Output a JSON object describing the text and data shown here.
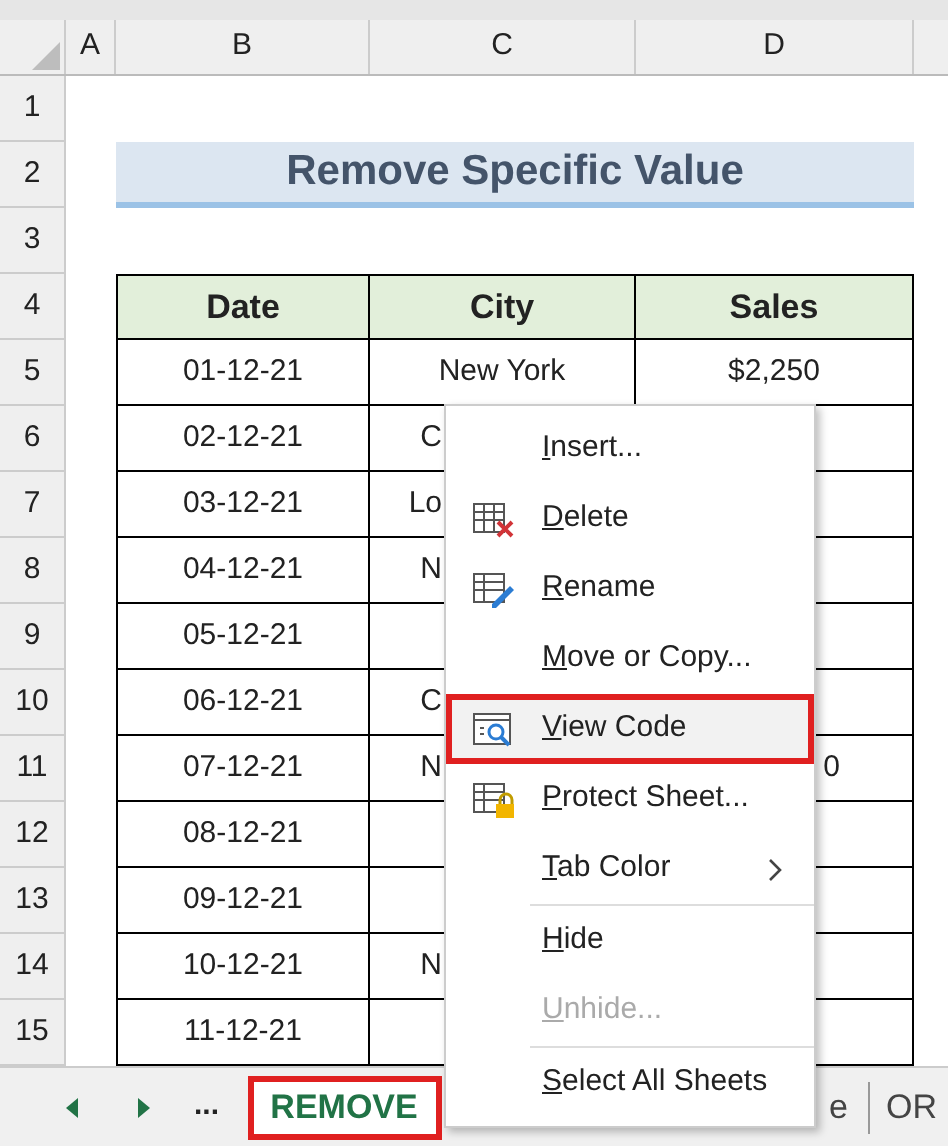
{
  "column_headers": [
    "A",
    "B",
    "C",
    "D"
  ],
  "row_numbers": [
    "1",
    "2",
    "3",
    "4",
    "5",
    "6",
    "7",
    "8",
    "9",
    "10",
    "11",
    "12",
    "13",
    "14",
    "15"
  ],
  "title": "Remove Specific Value",
  "table": {
    "headers": [
      "Date",
      "City",
      "Sales"
    ],
    "rows": [
      {
        "date": "01-12-21",
        "city": {
          "text": "New York",
          "kind": "full"
        },
        "sales": {
          "text": "$2,250",
          "kind": "full"
        }
      },
      {
        "date": "02-12-21",
        "city": {
          "text": "C",
          "kind": "partial"
        }
      },
      {
        "date": "03-12-21",
        "city": {
          "text": "Lo",
          "kind": "partial"
        }
      },
      {
        "date": "04-12-21",
        "city": {
          "text": "N",
          "kind": "partial"
        }
      },
      {
        "date": "05-12-21"
      },
      {
        "date": "06-12-21",
        "city": {
          "text": "C",
          "kind": "partial"
        }
      },
      {
        "date": "07-12-21",
        "city": {
          "text": "N",
          "kind": "partial"
        },
        "sales": {
          "text": "0",
          "kind": "partial"
        }
      },
      {
        "date": "08-12-21"
      },
      {
        "date": "09-12-21"
      },
      {
        "date": "10-12-21",
        "city": {
          "text": "N",
          "kind": "partial"
        }
      },
      {
        "date": "11-12-21"
      }
    ]
  },
  "context_menu": {
    "groups": [
      [
        {
          "label": "Insert...",
          "kind": "plain",
          "selected": false,
          "disabled": false,
          "submenu": false
        },
        {
          "label": "Delete",
          "kind": "delete",
          "selected": false,
          "disabled": false,
          "submenu": false
        },
        {
          "label": "Rename",
          "kind": "rename",
          "selected": false,
          "disabled": false,
          "submenu": false
        },
        {
          "label": "Move or Copy...",
          "kind": "plain",
          "selected": false,
          "disabled": false,
          "submenu": false
        },
        {
          "label": "View Code",
          "kind": "code",
          "selected": true,
          "disabled": false,
          "submenu": false
        },
        {
          "label": "Protect Sheet...",
          "kind": "protect",
          "selected": false,
          "disabled": false,
          "submenu": false
        },
        {
          "label": "Tab Color",
          "kind": "plain",
          "selected": false,
          "disabled": false,
          "submenu": true
        }
      ],
      [
        {
          "label": "Hide",
          "kind": "plain",
          "selected": false,
          "disabled": false,
          "submenu": false
        },
        {
          "label": "Unhide...",
          "kind": "plain",
          "selected": false,
          "disabled": true,
          "submenu": false
        }
      ],
      [
        {
          "label": "Select All Sheets",
          "kind": "plain",
          "selected": false,
          "disabled": false,
          "submenu": false
        }
      ]
    ]
  },
  "sheet_tabs": {
    "more": "...",
    "tabs": [
      {
        "label": "REMOVE",
        "selected": true
      },
      {
        "label": "e",
        "selected": false
      },
      {
        "label": "OR",
        "selected": false
      }
    ]
  }
}
